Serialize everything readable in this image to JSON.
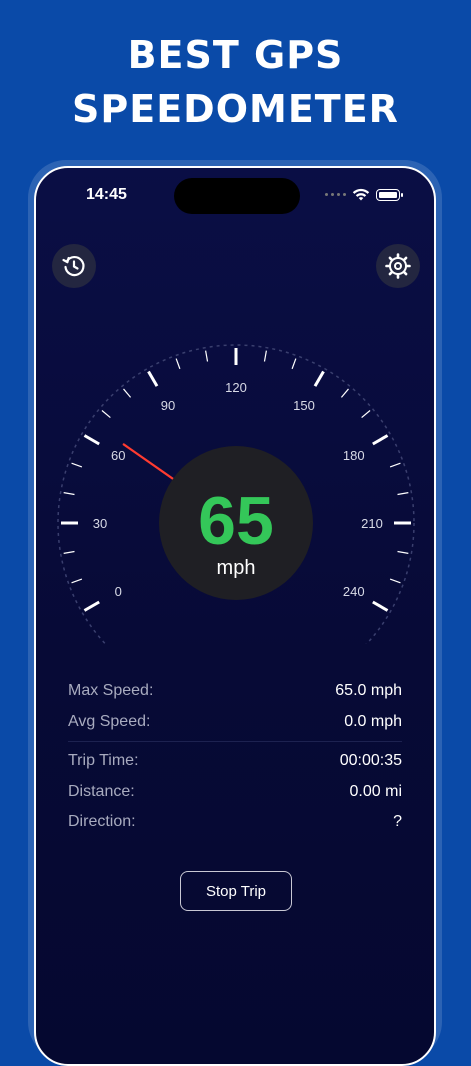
{
  "headline": {
    "line1": "BEST GPS",
    "line2": "SPEEDOMETER"
  },
  "status_bar": {
    "time": "14:45"
  },
  "toolbar": {
    "history_icon": "history-icon",
    "settings_icon": "gear-icon"
  },
  "speedometer": {
    "speed": "65",
    "unit": "mph",
    "needle_value": 65,
    "max_scale": 240,
    "tick_labels": [
      "0",
      "30",
      "60",
      "90",
      "120",
      "150",
      "180",
      "210",
      "240"
    ],
    "accent_color": "#34c759",
    "needle_color": "#ff3b30"
  },
  "stats": {
    "max_speed": {
      "label": "Max Speed:",
      "value": "65.0 mph"
    },
    "avg_speed": {
      "label": "Avg Speed:",
      "value": "0.0 mph"
    },
    "trip_time": {
      "label": "Trip Time:",
      "value": "00:00:35"
    },
    "distance": {
      "label": "Distance:",
      "value": "0.00 mi"
    },
    "direction": {
      "label": "Direction:",
      "value": "?"
    }
  },
  "actions": {
    "stop_trip": "Stop Trip"
  }
}
